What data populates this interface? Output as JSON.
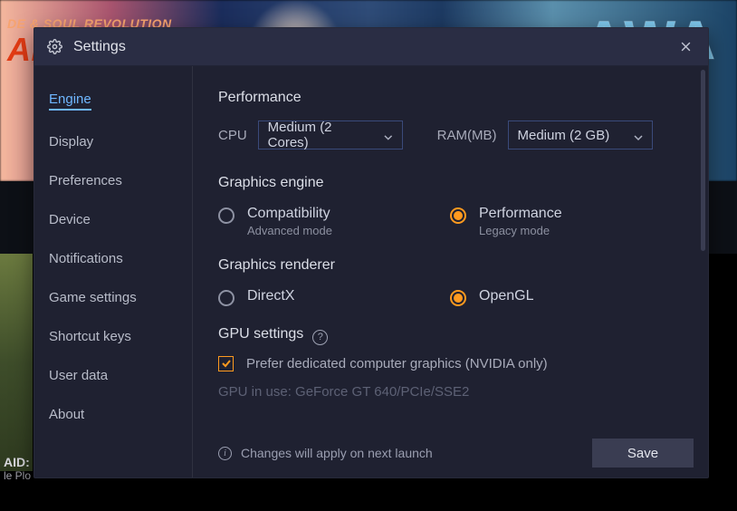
{
  "bg": {
    "top_line": "DE & SOUL REVOLUTION",
    "top_big": "AN",
    "right_word": "AWA",
    "caption_main": "AID: S",
    "caption_sub": "le Plo"
  },
  "title": "Settings",
  "sidebar": {
    "items": [
      {
        "label": "Engine",
        "active": true
      },
      {
        "label": "Display"
      },
      {
        "label": "Preferences"
      },
      {
        "label": "Device"
      },
      {
        "label": "Notifications"
      },
      {
        "label": "Game settings"
      },
      {
        "label": "Shortcut keys"
      },
      {
        "label": "User data"
      },
      {
        "label": "About"
      }
    ]
  },
  "performance": {
    "title": "Performance",
    "cpu_label": "CPU",
    "cpu_value": "Medium (2 Cores)",
    "ram_label": "RAM(MB)",
    "ram_value": "Medium (2 GB)"
  },
  "graphics_engine": {
    "title": "Graphics engine",
    "options": [
      {
        "label": "Compatibility",
        "sub": "Advanced mode",
        "checked": false
      },
      {
        "label": "Performance",
        "sub": "Legacy mode",
        "checked": true
      }
    ]
  },
  "graphics_renderer": {
    "title": "Graphics renderer",
    "options": [
      {
        "label": "DirectX",
        "checked": false
      },
      {
        "label": "OpenGL",
        "checked": true
      }
    ]
  },
  "gpu": {
    "title": "GPU settings",
    "prefer_label": "Prefer dedicated computer graphics (NVIDIA only)",
    "in_use": "GPU in use: GeForce GT 640/PCIe/SSE2"
  },
  "footer": {
    "info": "Changes will apply on next launch",
    "save": "Save"
  }
}
